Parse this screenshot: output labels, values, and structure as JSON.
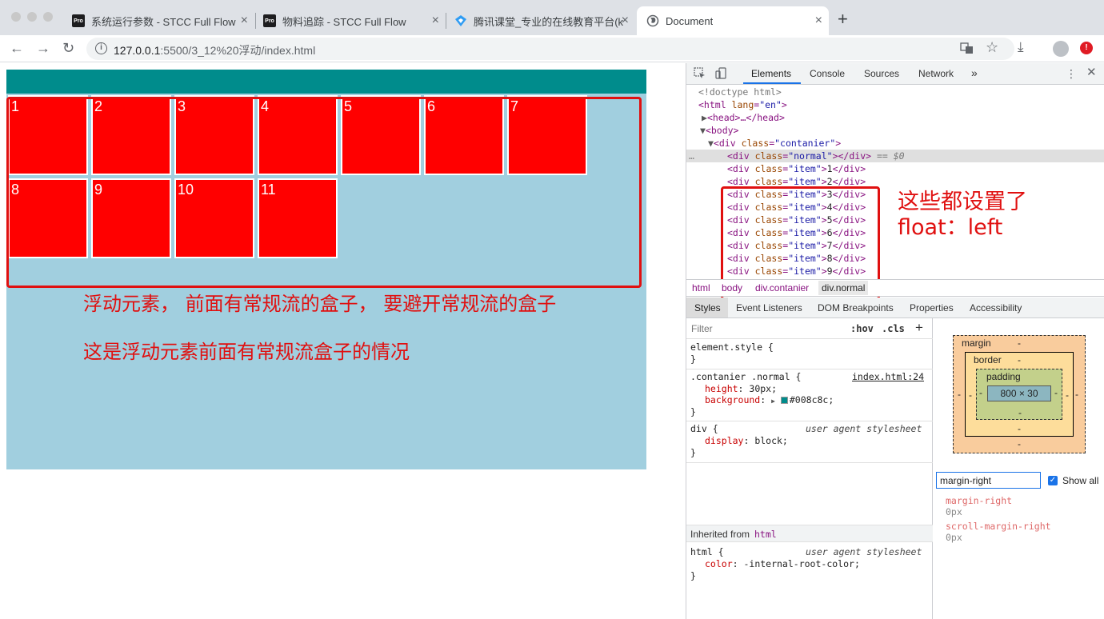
{
  "browser": {
    "tabs": [
      {
        "title": "系统运行参数 - STCC Full Flow",
        "favicon": "Pro"
      },
      {
        "title": "物料追踪 - STCC Full Flow",
        "favicon": "Pro"
      },
      {
        "title": "腾讯课堂_专业的在线教育平台(k",
        "favicon": "tencent-classroom-icon"
      },
      {
        "title": "Document",
        "favicon": "globe-icon"
      }
    ],
    "address": {
      "host": "127.0.0.1",
      "rest": ":5500/3_12%20浮动/index.html"
    },
    "ext_label": "!"
  },
  "page": {
    "items": [
      "1",
      "2",
      "3",
      "4",
      "5",
      "6",
      "7",
      "8",
      "9",
      "10",
      "11"
    ],
    "note_line1": "浮动元素， 前面有常规流的盒子， 要避开常规流的盒子",
    "note_line2": "这是浮动元素前面有常规流盒子的情况",
    "colors": {
      "normal": "#008c8c",
      "container": "#a1cfdf",
      "item": "#ff0000",
      "annotation": "#e01010"
    }
  },
  "devtools": {
    "tabs": [
      "Elements",
      "Console",
      "Sources",
      "Network",
      "»"
    ],
    "annotation_line1": "这些都设置了",
    "annotation_line2": "float：left",
    "dom": {
      "doctype": "<!doctype html>",
      "html_open": "<html ",
      "html_attr": "lang",
      "html_val": "\"en\"",
      "html_close": ">",
      "head": "<head>…</head>",
      "body": "<body>",
      "div_open": "<div ",
      "class_attr": "class",
      "contanier_val": "\"contanier\"",
      "gt": ">",
      "normal_val": "\"normal\"",
      "close_div": "></div>",
      "sel_marker": " == $0",
      "item_val": "\"item\"",
      "ellipsis": "…",
      "item_rows": [
        "1",
        "2",
        "3",
        "4",
        "5",
        "6",
        "7",
        "8",
        "9"
      ]
    },
    "breadcrumbs": [
      "html",
      "body",
      "div.contanier",
      "div.normal"
    ],
    "subtabs": [
      "Styles",
      "Event Listeners",
      "DOM Breakpoints",
      "Properties",
      "Accessibility"
    ],
    "styles": {
      "filter_placeholder": "Filter",
      "hov": ":hov",
      "cls": ".cls",
      "plus": "+",
      "element_style": "element.style {",
      "close": "}",
      "rule1_selector": ".contanier .normal {",
      "rule1_source": "index.html:24",
      "rule1_p1_name": "height",
      "rule1_p1_value": ": 30px;",
      "rule1_p2_name": "background",
      "rule1_p2_value": "#008c8c;",
      "rule2_selector": "div {",
      "rule2_source": "user agent stylesheet",
      "rule2_p1_name": "display",
      "rule2_p1_value": ": block;",
      "inherited_label": "Inherited from",
      "inherited_tag": "html",
      "rule3_selector": "html {",
      "rule3_source": "user agent stylesheet",
      "rule3_p1_name": "color",
      "rule3_p1_value": ": -internal-root-color;"
    },
    "boxmodel": {
      "margin_label": "margin",
      "border_label": "border",
      "padding_label": "padding",
      "content_size": "800 × 30",
      "dash": "-"
    },
    "computed": {
      "filter_value": "margin-right",
      "show_all": "Show all",
      "props": [
        {
          "name": "margin-right",
          "value": "0px"
        },
        {
          "name": "scroll-margin-right",
          "value": "0px"
        }
      ]
    }
  }
}
